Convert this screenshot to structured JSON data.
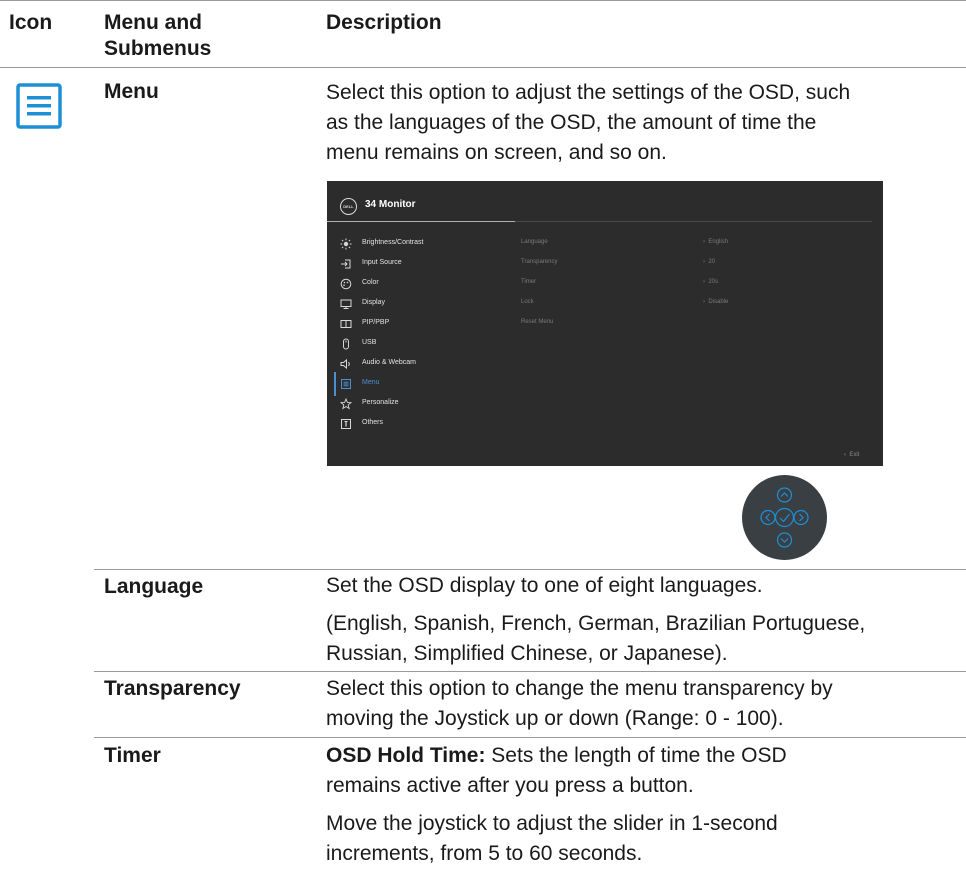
{
  "headers": {
    "icon": "Icon",
    "menu_line1": "Menu and",
    "menu_line2": "Submenus",
    "description": "Description"
  },
  "menu_row": {
    "icon": "menu-list-icon",
    "name": "Menu",
    "description_lines": [
      "Select this option to adjust the settings of the OSD, such",
      "as the languages of the OSD, the amount of time the",
      "menu remains on screen, and so on."
    ]
  },
  "osd": {
    "logo": "DELL",
    "title": "34 Monitor",
    "menu_items": [
      {
        "label": "Brightness/Contrast",
        "icon": "brightness-icon"
      },
      {
        "label": "Input Source",
        "icon": "input-source-icon"
      },
      {
        "label": "Color",
        "icon": "color-icon"
      },
      {
        "label": "Display",
        "icon": "display-icon"
      },
      {
        "label": "PIP/PBP",
        "icon": "pip-pbp-icon"
      },
      {
        "label": "USB",
        "icon": "usb-icon"
      },
      {
        "label": "Audio & Webcam",
        "icon": "audio-icon"
      },
      {
        "label": "Menu",
        "icon": "menu-icon",
        "active": true
      },
      {
        "label": "Personalize",
        "icon": "star-icon"
      },
      {
        "label": "Others",
        "icon": "others-icon"
      }
    ],
    "submenu": [
      {
        "label": "Language",
        "value": "English"
      },
      {
        "label": "Transparency",
        "value": "20"
      },
      {
        "label": "Timer",
        "value": "20s"
      },
      {
        "label": "Lock",
        "value": "Disable"
      },
      {
        "label": "Reset Menu",
        "value": ""
      }
    ],
    "exit": "Exit",
    "accent": "#4d8fcf"
  },
  "rows": {
    "language": {
      "name": "Language",
      "line1": "Set the OSD display to one of eight languages.",
      "line2": "(English, Spanish, French, German, Brazilian Portuguese,",
      "line3": "Russian, Simplified Chinese, or Japanese)."
    },
    "transparency": {
      "name": "Transparency",
      "line1": "Select this option to change the menu transparency by",
      "line2": "moving the Joystick up or down (Range: 0 - 100)."
    },
    "timer": {
      "name": "Timer",
      "bold_label": "OSD Hold Time:",
      "line1_rest": " Sets the length of time the OSD",
      "line2": "remains active after you press a button.",
      "line3": "Move the joystick to adjust the slider in 1-second",
      "line4": "increments, from 5 to 60 seconds."
    }
  },
  "colors": {
    "icon_blue": "#1d8fd6",
    "rule": "#9a9a9a",
    "osd_bg": "#2c2c2c"
  }
}
